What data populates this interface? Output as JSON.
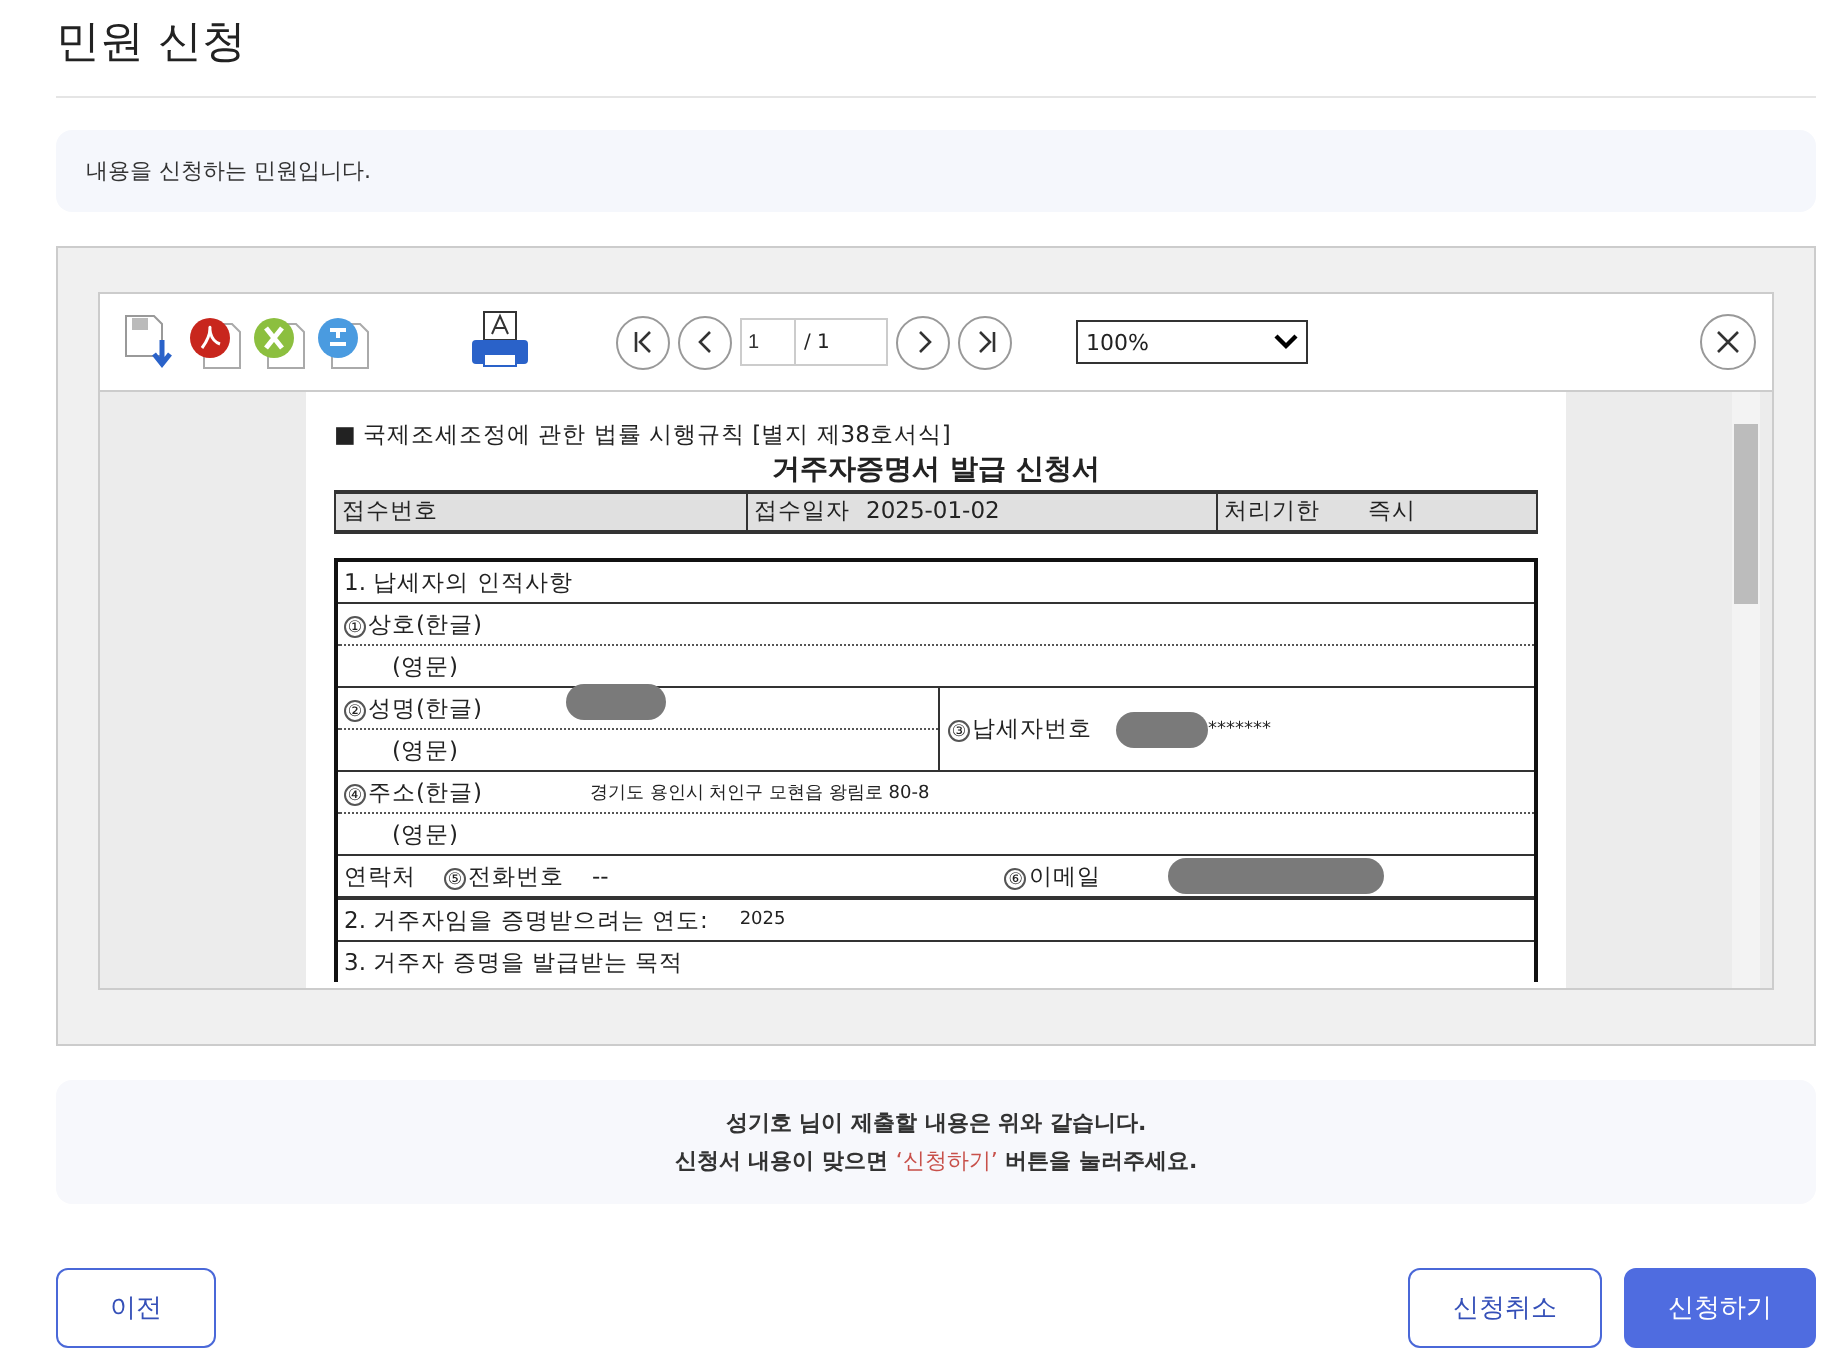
{
  "page_title": "민원 신청",
  "info": "내용을 신청하는 민원입니다.",
  "viewer": {
    "page_input": "1",
    "page_total": "/ 1",
    "zoom": "100%"
  },
  "document": {
    "header": "■ 국제조세조정에 관한 법률 시행규칙 [별지 제38호서식]",
    "title": "거주자증명서 발급 신청서",
    "receipt": [
      {
        "label": "접수번호"
      },
      {
        "label": "접수일자",
        "value": "2025-01-02"
      },
      {
        "label": "처리기한",
        "value": "즉시"
      }
    ],
    "section1": "1. 납세자의 인적사항",
    "trade_name": {
      "mark": "①",
      "label": "상호(한글)",
      "english": "(영문)"
    },
    "name": {
      "mark": "②",
      "label": "성명(한글)",
      "english": "(영문)"
    },
    "taxpayer_no": {
      "mark": "③",
      "label": "납세자번호",
      "suffix": "*******"
    },
    "address": {
      "mark": "④",
      "label": "주소(한글)",
      "value": "경기도 용인시 처인구 모현읍 왕림로 80-8",
      "english": "(영문)"
    },
    "contact": {
      "label": "연락처",
      "phone_mark": "⑤",
      "phone_label": "전화번호",
      "phone": "--",
      "email_mark": "⑥",
      "email_label": "이메일"
    },
    "section2": {
      "label": "2. 거주자임을 증명받으려는 연도:",
      "value": "2025"
    },
    "section3": "3. 거주자 증명을 발급받는 목적"
  },
  "notice": {
    "line1": "성기호 님이 제출할 내용은 위와 같습니다.",
    "line2_before": "신청서 내용이 맞으면 ",
    "line2_highlight": "‘신청하기’",
    "line2_after": " 버튼을 눌러주세요."
  },
  "buttons": {
    "prev": "이전",
    "cancel": "신청취소",
    "submit": "신청하기"
  }
}
